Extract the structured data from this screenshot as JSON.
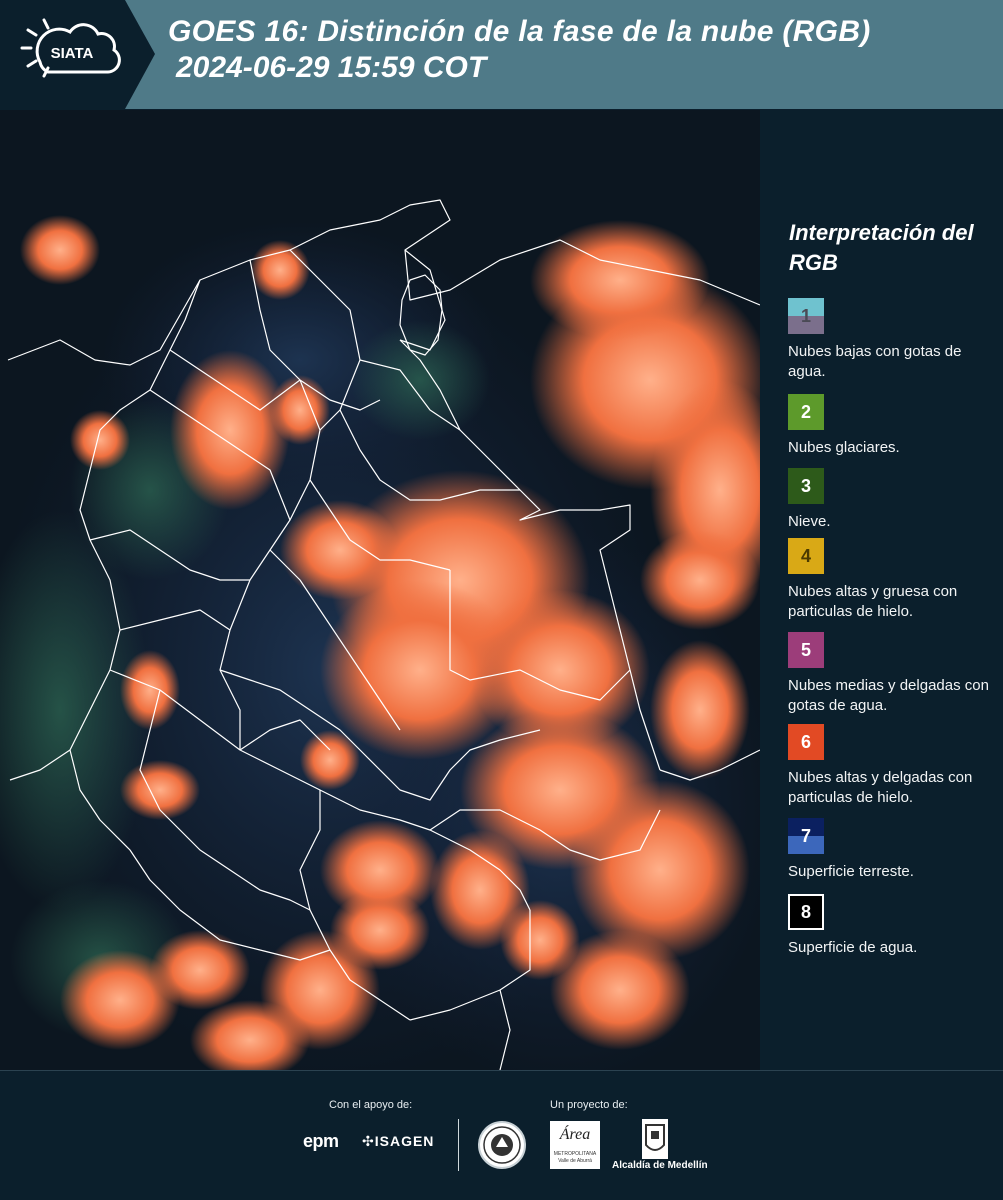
{
  "header": {
    "logo_text": "SIATA",
    "title": "GOES 16: Distinción de la fase de la nube (RGB)",
    "subtitle": "2024-06-29 15:59 COT"
  },
  "legend": {
    "title": "Interpretación del RGB",
    "items": [
      {
        "num": "1",
        "label": "Nubes bajas con gotas de agua.",
        "color_top": "#6fc2cf",
        "color_bottom": "#7b6f8c"
      },
      {
        "num": "2",
        "label": "Nubes glaciares.",
        "color": "#5d9a2b"
      },
      {
        "num": "3",
        "label": "Nieve.",
        "color": "#2d5a1a"
      },
      {
        "num": "4",
        "label": "Nubes altas y gruesa con particulas de hielo.",
        "color": "#d9a916"
      },
      {
        "num": "5",
        "label": "Nubes medias y delgadas con gotas de agua.",
        "color": "#9c3d7a"
      },
      {
        "num": "6",
        "label": "Nubes altas y delgadas con particulas de hielo.",
        "color": "#e24a24"
      },
      {
        "num": "7",
        "label": "Superficie terreste.",
        "color_top": "#0b2060",
        "color_bottom": "#3c67bb"
      },
      {
        "num": "8",
        "label": "Superficie de agua.",
        "color": "#000000"
      }
    ]
  },
  "footer": {
    "support_label": "Con el apoyo de:",
    "project_label": "Un proyecto de:",
    "epm": "epm",
    "isagen": "ISAGEN",
    "area_logo": "Área",
    "area_sub": "METROPOLITANA Valle de Aburrá",
    "alcaldia": "Alcaldía de Medellín"
  },
  "colors": {
    "header_bg": "#4f7a88",
    "page_bg": "#0b1f2c",
    "cloud_orange": "#f27a45"
  }
}
